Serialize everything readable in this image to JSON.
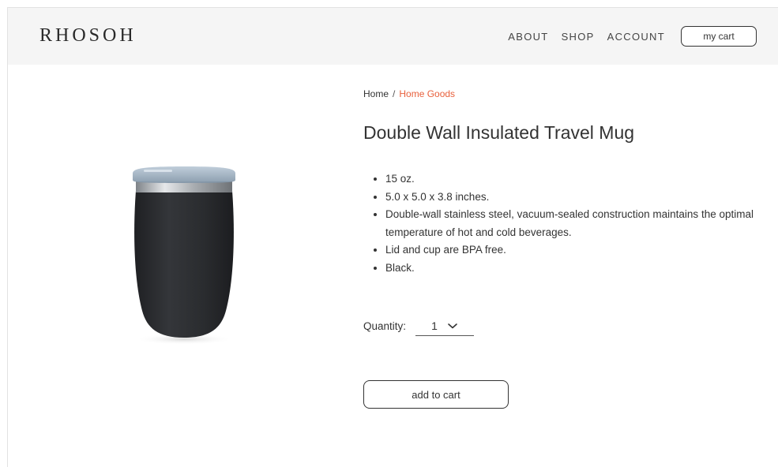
{
  "header": {
    "logo": "RHOSOH",
    "nav": {
      "about": "ABOUT",
      "shop": "SHOP",
      "account": "ACCOUNT"
    },
    "cart_label": "my cart"
  },
  "breadcrumb": {
    "home": "Home",
    "separator": "/",
    "current": "Home Goods"
  },
  "product": {
    "title": "Double Wall Insulated Travel Mug",
    "features": [
      "15 oz.",
      "5.0 x 5.0 x 3.8 inches.",
      "Double-wall stainless steel, vacuum-sealed construction maintains the optimal temperature of hot and cold beverages.",
      "Lid and cup are BPA free.",
      "Black."
    ],
    "quantity_label": "Quantity:",
    "quantity_value": "1",
    "add_to_cart_label": "add to cart"
  },
  "colors": {
    "header_bg": "#f5f5f5",
    "accent": "#e8603c",
    "text": "#333333",
    "mug_body": "#2b2d30"
  },
  "icons": {
    "quantity_dropdown": "chevron-down-icon",
    "product_image": "travel-mug-image"
  }
}
